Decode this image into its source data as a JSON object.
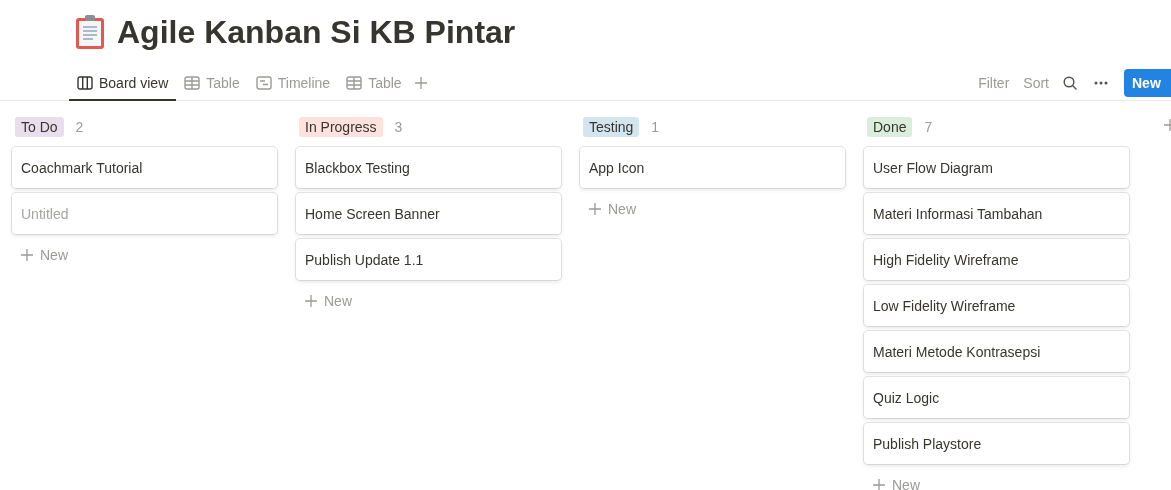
{
  "page": {
    "title": "Agile Kanban Si KB Pintar"
  },
  "views": [
    {
      "label": "Board view",
      "kind": "board",
      "selected": true
    },
    {
      "label": "Table",
      "kind": "table",
      "selected": false
    },
    {
      "label": "Timeline",
      "kind": "timeline",
      "selected": false
    },
    {
      "label": "Table",
      "kind": "table",
      "selected": false
    }
  ],
  "toolbar": {
    "filter": "Filter",
    "sort": "Sort",
    "new_button": "New"
  },
  "groups": [
    {
      "name": "To Do",
      "count": "2",
      "color": "#e8deee",
      "cards": [
        {
          "title": "Coachmark Tutorial",
          "kind": "page"
        },
        {
          "title": "Untitled",
          "kind": "untitled"
        }
      ],
      "add_label": "New"
    },
    {
      "name": "In Progress",
      "count": "3",
      "color": "#ffe2dd",
      "cards": [
        {
          "title": "Blackbox Testing",
          "kind": "page"
        },
        {
          "title": "Home Screen Banner",
          "kind": "page"
        },
        {
          "title": "Publish Update 1.1",
          "kind": "page"
        }
      ],
      "add_label": "New"
    },
    {
      "name": "Testing",
      "count": "1",
      "color": "#d3e5ef",
      "cards": [
        {
          "title": "App Icon",
          "kind": "page"
        }
      ],
      "add_label": "New"
    },
    {
      "name": "Done",
      "count": "7",
      "color": "#dbeddb",
      "cards": [
        {
          "title": "User Flow Diagram",
          "kind": "page"
        },
        {
          "title": "Materi Informasi Tambahan",
          "kind": "page"
        },
        {
          "title": "High Fidelity Wireframe",
          "kind": "page"
        },
        {
          "title": "Low Fidelity Wireframe",
          "kind": "page"
        },
        {
          "title": "Materi Metode Kontrasepsi",
          "kind": "page"
        },
        {
          "title": "Quiz Logic",
          "kind": "page"
        },
        {
          "title": "Publish Playstore",
          "kind": "page"
        }
      ],
      "add_label": "New"
    }
  ]
}
